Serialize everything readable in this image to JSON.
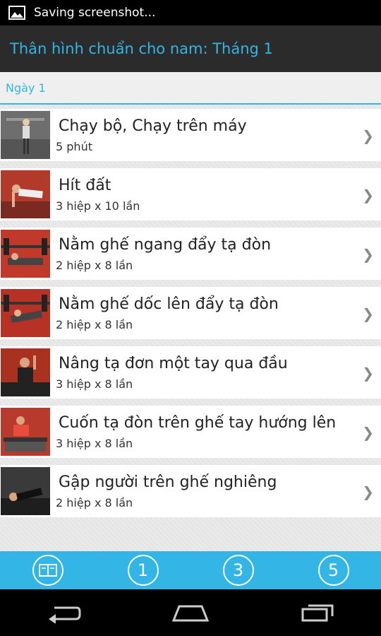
{
  "status": {
    "text": "Saving screenshot..."
  },
  "header": {
    "title": "Thân hình chuẩn cho nam: Tháng 1"
  },
  "section": {
    "label": "Ngày 1"
  },
  "exercises": [
    {
      "title": "Chạy bộ, Chạy trên máy",
      "detail": "5 phút"
    },
    {
      "title": "Hít đất",
      "detail": "3 hiệp x 10 lần"
    },
    {
      "title": "Nằm ghế ngang đẩy tạ đòn",
      "detail": "2 hiệp x 8 lần"
    },
    {
      "title": "Nằm ghế dốc lên đẩy tạ đòn",
      "detail": "2 hiệp x 8 lần"
    },
    {
      "title": "Nâng tạ đơn một tay qua đầu",
      "detail": "3 hiệp x 8 lần"
    },
    {
      "title": "Cuốn tạ đòn trên ghế tay hướng lên",
      "detail": "3 hiệp x 8 lần"
    },
    {
      "title": "Gập người trên ghế nghiêng",
      "detail": "2 hiệp x 8 lần"
    }
  ],
  "bottom_tabs": {
    "tab1": "1",
    "tab3": "3",
    "tab5": "5"
  },
  "colors": {
    "accent": "#33b5e5",
    "actionbar": "#2b2b2b"
  }
}
